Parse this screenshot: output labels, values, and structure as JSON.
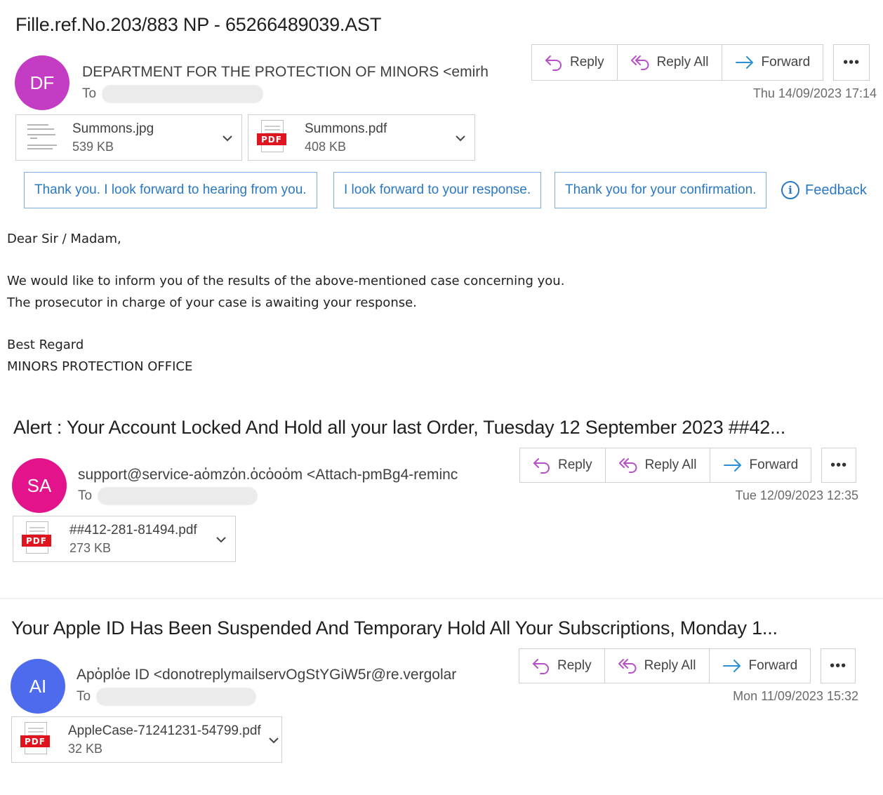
{
  "actions": {
    "reply": "Reply",
    "reply_all": "Reply All",
    "forward": "Forward",
    "more": "•••"
  },
  "colors": {
    "reply_icon": "#b64fc8",
    "forward_icon": "#2b8fd6",
    "quick_reply_text": "#2b78c2",
    "pdf_badge": "#e0141e"
  },
  "emails": [
    {
      "subject": "Fille.ref.No.203/883 NP - 65266489039.AST",
      "avatar_initials": "DF",
      "avatar_color": "#c43cc4",
      "sender": "DEPARTMENT FOR THE PROTECTION OF MINORS <emirh",
      "to_label": "To",
      "timestamp": "Thu 14/09/2023 17:14",
      "attachments": [
        {
          "name": "Summons.jpg",
          "size": "539 KB",
          "type": "image-thumbnail"
        },
        {
          "name": "Summons.pdf",
          "size": "408 KB",
          "type": "pdf",
          "badge": "PDF"
        }
      ],
      "quick_replies": [
        "Thank you. I look forward to hearing from you.",
        "I look forward to your response.",
        "Thank you for your confirmation."
      ],
      "feedback_label": "Feedback",
      "body": {
        "greeting": "Dear Sir / Madam,",
        "lines": [
          "We would like to inform you of the results of the above-mentioned case concerning you.",
          "The prosecutor in charge of your case is awaiting your response."
        ],
        "signoff": "Best Regard",
        "signature": "MINORS PROTECTION OFFICE"
      }
    },
    {
      "subject": "Alert : Your Account Locked And Hold all your last Order, Tuesday 12 September 2023 ##42...",
      "avatar_initials": "SA",
      "avatar_color": "#e3138c",
      "sender": "support@service-aὁmzὁn.ὁcὁoὁm <Attach-pmBg4-reminc",
      "to_label": "To",
      "timestamp": "Tue 12/09/2023 12:35",
      "attachments": [
        {
          "name": "##412-281-81494.pdf",
          "size": "273 KB",
          "type": "pdf",
          "badge": "PDF"
        }
      ]
    },
    {
      "subject": "Your Apple ID Has Been Suspended And Temporary Hold All Your Subscriptions, Monday 1...",
      "avatar_initials": "AI",
      "avatar_color": "#4f6bed",
      "sender": "Apὁplὁe ID <donotreplymailservOgStYGiW5r@re.vergolar",
      "to_label": "To",
      "timestamp": "Mon 11/09/2023 15:32",
      "attachments": [
        {
          "name": "AppleCase-71241231-54799.pdf",
          "size": "32 KB",
          "type": "pdf",
          "badge": "PDF"
        }
      ]
    }
  ]
}
